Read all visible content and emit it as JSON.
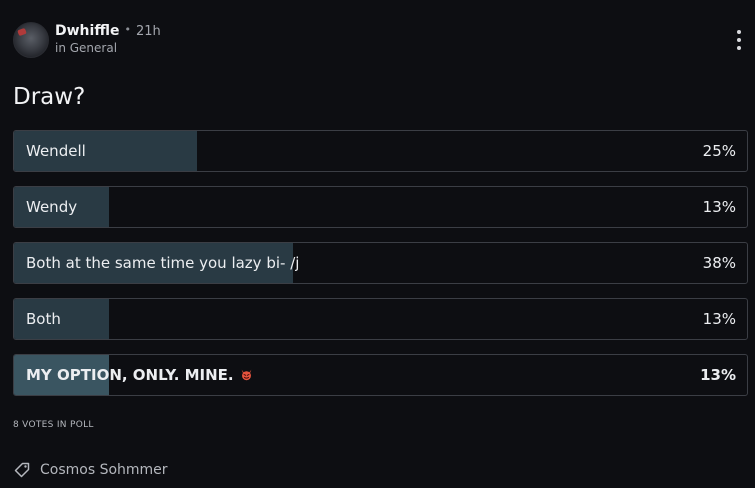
{
  "post": {
    "author": "Dwhiffle",
    "separator": "•",
    "timestamp": "21h",
    "community": "in General",
    "title": "Draw?"
  },
  "poll": {
    "options": [
      {
        "label": "Wendell",
        "percent_text": "25%",
        "percent": 25,
        "selected": false
      },
      {
        "label": "Wendy",
        "percent_text": "13%",
        "percent": 13,
        "selected": false
      },
      {
        "label": "Both at the same time you lazy bi- /j",
        "percent_text": "38%",
        "percent": 38,
        "selected": false
      },
      {
        "label": "Both",
        "percent_text": "13%",
        "percent": 13,
        "selected": false
      },
      {
        "label": "MY OPTION, ONLY. MINE.",
        "emoji": "devil-emoji",
        "percent_text": "13%",
        "percent": 13,
        "selected": true
      }
    ],
    "votes_text": "8 VOTES IN POLL"
  },
  "tag": {
    "icon": "tag-icon",
    "label": "Cosmos Sohmmer"
  },
  "colors": {
    "background": "#0d0e12",
    "option_border": "#3b3e45",
    "fill": "#293a44",
    "fill_selected": "#3a5561",
    "text": "#eceef1",
    "muted": "#a3a6ad"
  }
}
